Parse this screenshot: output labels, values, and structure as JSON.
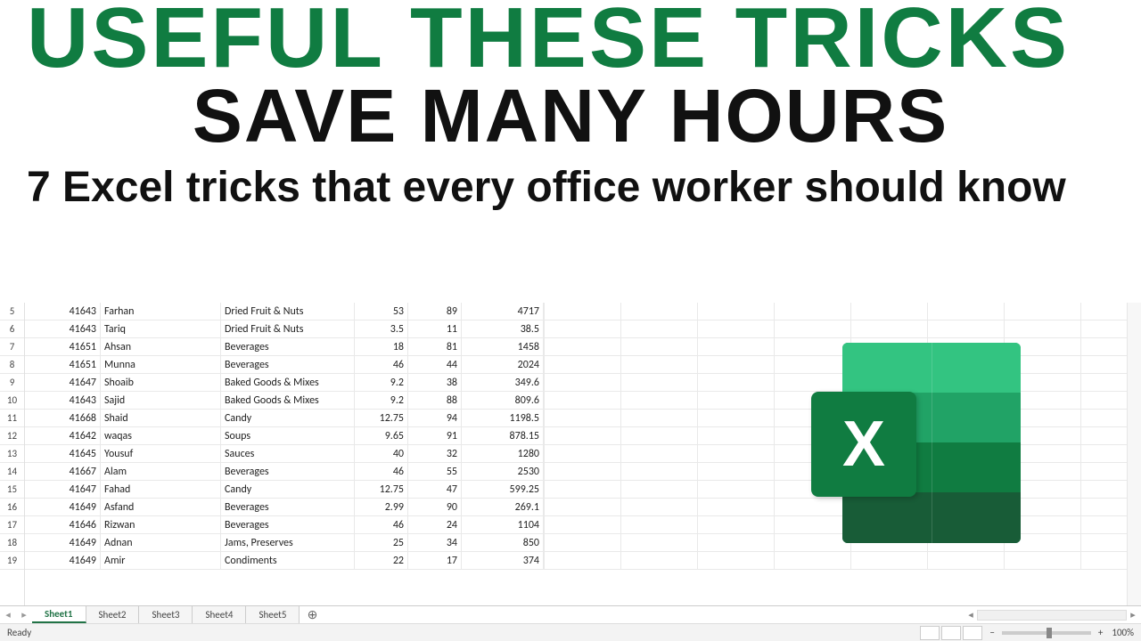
{
  "hero": {
    "title1": "USEFUL THESE TRICKS",
    "title2": "SAVE MANY HOURS",
    "subtitle": "7 Excel tricks that every office worker should know"
  },
  "rows": [
    {
      "n": 5,
      "a": "41643",
      "b": "Farhan",
      "c": "Dried Fruit & Nuts",
      "d": "53",
      "e": "89",
      "f": "4717"
    },
    {
      "n": 6,
      "a": "41643",
      "b": "Tariq",
      "c": "Dried Fruit & Nuts",
      "d": "3.5",
      "e": "11",
      "f": "38.5"
    },
    {
      "n": 7,
      "a": "41651",
      "b": "Ahsan",
      "c": "Beverages",
      "d": "18",
      "e": "81",
      "f": "1458"
    },
    {
      "n": 8,
      "a": "41651",
      "b": "Munna",
      "c": "Beverages",
      "d": "46",
      "e": "44",
      "f": "2024"
    },
    {
      "n": 9,
      "a": "41647",
      "b": "Shoaib",
      "c": "Baked Goods & Mixes",
      "d": "9.2",
      "e": "38",
      "f": "349.6"
    },
    {
      "n": 10,
      "a": "41643",
      "b": "Sajid",
      "c": "Baked Goods & Mixes",
      "d": "9.2",
      "e": "88",
      "f": "809.6"
    },
    {
      "n": 11,
      "a": "41668",
      "b": "Shaid",
      "c": "Candy",
      "d": "12.75",
      "e": "94",
      "f": "1198.5"
    },
    {
      "n": 12,
      "a": "41642",
      "b": "waqas",
      "c": "Soups",
      "d": "9.65",
      "e": "91",
      "f": "878.15"
    },
    {
      "n": 13,
      "a": "41645",
      "b": "Yousuf",
      "c": "Sauces",
      "d": "40",
      "e": "32",
      "f": "1280"
    },
    {
      "n": 14,
      "a": "41667",
      "b": "Alam",
      "c": "Beverages",
      "d": "46",
      "e": "55",
      "f": "2530"
    },
    {
      "n": 15,
      "a": "41647",
      "b": "Fahad",
      "c": "Candy",
      "d": "12.75",
      "e": "47",
      "f": "599.25"
    },
    {
      "n": 16,
      "a": "41649",
      "b": "Asfand",
      "c": "Beverages",
      "d": "2.99",
      "e": "90",
      "f": "269.1"
    },
    {
      "n": 17,
      "a": "41646",
      "b": "Rizwan",
      "c": "Beverages",
      "d": "46",
      "e": "24",
      "f": "1104"
    },
    {
      "n": 18,
      "a": "41649",
      "b": "Adnan",
      "c": "Jams, Preserves",
      "d": "25",
      "e": "34",
      "f": "850"
    },
    {
      "n": 19,
      "a": "41649",
      "b": "Amir",
      "c": "Condiments",
      "d": "22",
      "e": "17",
      "f": "374"
    }
  ],
  "tabs": [
    "Sheet1",
    "Sheet2",
    "Sheet3",
    "Sheet4",
    "Sheet5"
  ],
  "activeTab": 0,
  "status": {
    "ready": "Ready",
    "zoom": "100%",
    "plus": "+",
    "minus": "−"
  },
  "logo": {
    "letter": "X"
  },
  "nav": {
    "prev": "◂",
    "next": "▸",
    "first": "◂",
    "last": "▸",
    "plus": "⊕"
  }
}
